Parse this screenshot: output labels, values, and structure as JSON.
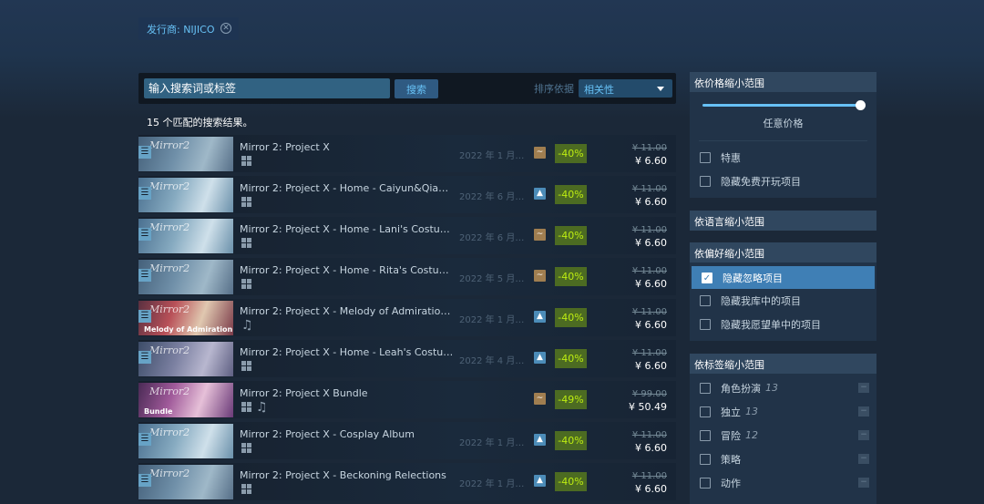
{
  "publisher_filter": {
    "label": "发行商: NIJICO",
    "remove_icon": "close-circle-icon"
  },
  "search": {
    "placeholder": "输入搜索词或标签",
    "button_label": "搜索",
    "sort_label": "排序依据",
    "sort_value": "相关性"
  },
  "result_count": "15 个匹配的搜索结果。",
  "results": [
    {
      "title": "Mirror 2: Project X",
      "date": "2022 年 1 月 2…",
      "platforms": [
        "windows"
      ],
      "review": "mixed",
      "discount": "-40%",
      "original_price": "¥ 11.00",
      "final_price": "¥ 6.60",
      "thumb_brand": "Mirror2"
    },
    {
      "title": "Mirror 2: Project X - Home - Caiyun&Qianxi's C…",
      "date": "2022 年 6 月 …",
      "platforms": [
        "windows"
      ],
      "review": "positive",
      "discount": "-40%",
      "original_price": "¥ 11.00",
      "final_price": "¥ 6.60",
      "thumb_brand": "Mirror2"
    },
    {
      "title": "Mirror 2: Project X - Home - Lani's Costumes",
      "date": "2022 年 6 月 …",
      "platforms": [
        "windows"
      ],
      "review": "mixed",
      "discount": "-40%",
      "original_price": "¥ 11.00",
      "final_price": "¥ 6.60",
      "thumb_brand": "Mirror2"
    },
    {
      "title": "Mirror 2: Project X - Home - Rita's Costumes",
      "date": "2022 年 5 月 …",
      "platforms": [
        "windows"
      ],
      "review": "mixed",
      "discount": "-40%",
      "original_price": "¥ 11.00",
      "final_price": "¥ 6.60",
      "thumb_brand": "Mirror2"
    },
    {
      "title": "Mirror 2: Project X - Melody of Admiration OST",
      "date": "2022 年 1 月 2…",
      "platforms": [
        "music"
      ],
      "review": "positive",
      "discount": "-40%",
      "original_price": "¥ 11.00",
      "final_price": "¥ 6.60",
      "thumb_brand": "Mirror2",
      "thumb_sub": "Melody of Admiration"
    },
    {
      "title": "Mirror 2: Project X - Home - Leah's Costumes",
      "date": "2022 年 4 月 …",
      "platforms": [
        "windows"
      ],
      "review": "positive",
      "discount": "-40%",
      "original_price": "¥ 11.00",
      "final_price": "¥ 6.60",
      "thumb_brand": "Mirror2"
    },
    {
      "title": "Mirror 2: Project X Bundle",
      "date": "",
      "platforms": [
        "windows",
        "music"
      ],
      "review": "mixed",
      "discount": "-49%",
      "original_price": "¥ 99.00",
      "final_price": "¥ 50.49",
      "thumb_brand": "Mirror2",
      "thumb_sub": "Bundle"
    },
    {
      "title": "Mirror 2: Project X - Cosplay Album",
      "date": "2022 年 1 月 2…",
      "platforms": [
        "windows"
      ],
      "review": "positive",
      "discount": "-40%",
      "original_price": "¥ 11.00",
      "final_price": "¥ 6.60",
      "thumb_brand": "Mirror2"
    },
    {
      "title": "Mirror 2: Project X - Beckoning Relections",
      "date": "2022 年 1 月 2…",
      "platforms": [
        "windows"
      ],
      "review": "positive",
      "discount": "-40%",
      "original_price": "¥ 11.00",
      "final_price": "¥ 6.60",
      "thumb_brand": "Mirror2"
    }
  ],
  "price_filter": {
    "header": "依价格缩小范围",
    "slider_caption": "任意价格",
    "slider_value": 1.0,
    "options": [
      {
        "label": "特惠",
        "checked": false
      },
      {
        "label": "隐藏免费开玩项目",
        "checked": false
      }
    ]
  },
  "language_filter": {
    "header": "依语言缩小范围"
  },
  "preference_filter": {
    "header": "依偏好缩小范围",
    "options": [
      {
        "label": "隐藏忽略项目",
        "checked": true
      },
      {
        "label": "隐藏我库中的项目",
        "checked": false
      },
      {
        "label": "隐藏我愿望单中的项目",
        "checked": false
      }
    ]
  },
  "tag_filter": {
    "header": "依标签缩小范围",
    "tags": [
      {
        "label": "角色扮演",
        "count": "13"
      },
      {
        "label": "独立",
        "count": "13"
      },
      {
        "label": "冒险",
        "count": "12"
      },
      {
        "label": "策略",
        "count": ""
      },
      {
        "label": "动作",
        "count": ""
      }
    ]
  },
  "colors": {
    "accent": "#67c1f5",
    "discount_bg": "#4c6b22",
    "discount_fg": "#beee11",
    "checked_bg": "#3f7fb5"
  }
}
